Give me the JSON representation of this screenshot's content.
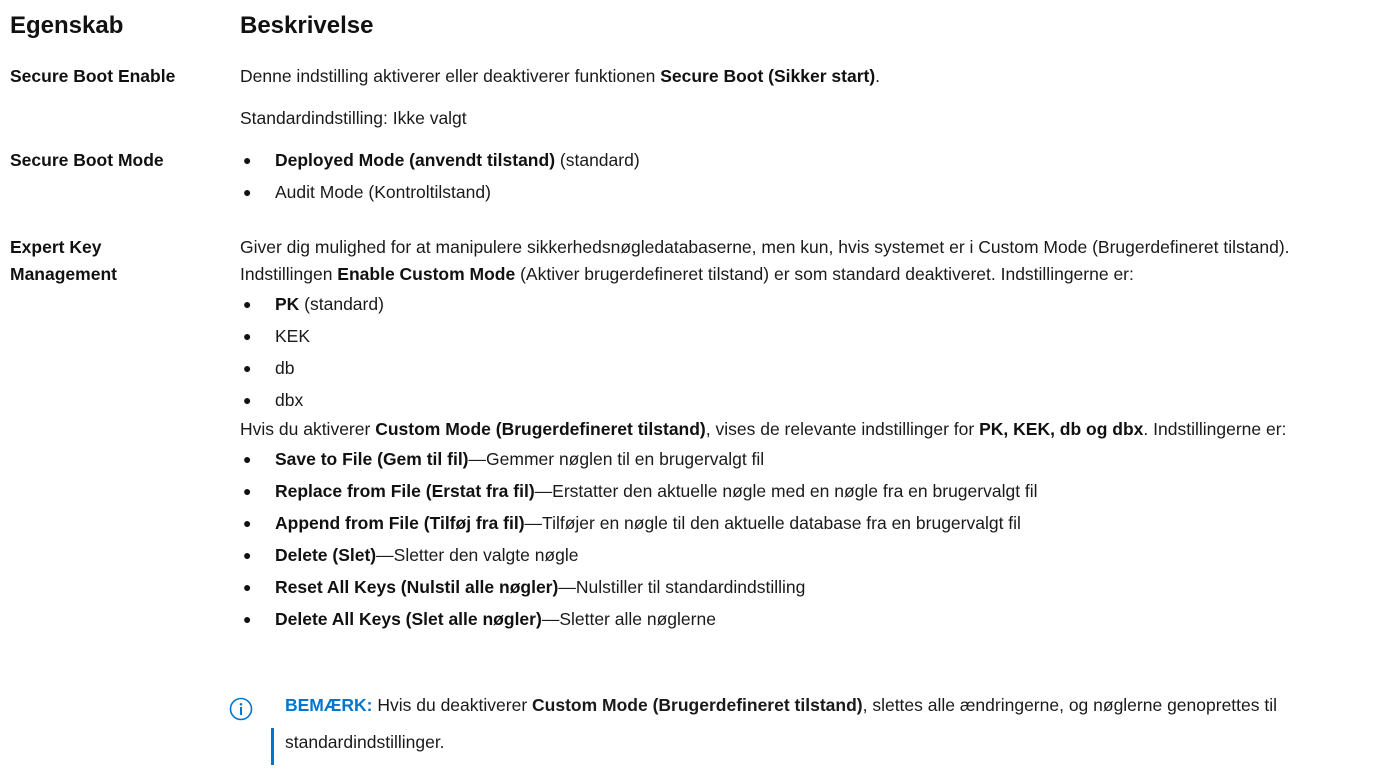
{
  "header": {
    "col1": "Egenskab",
    "col2": "Beskrivelse"
  },
  "rows": {
    "secure_boot_enable": {
      "label": "Secure Boot Enable",
      "line1_pre": "Denne indstilling aktiverer eller deaktiverer funktionen ",
      "line1_bold": "Secure Boot (Sikker start)",
      "line1_post": ".",
      "line2": "Standardindstilling: Ikke valgt"
    },
    "secure_boot_mode": {
      "label": "Secure Boot Mode",
      "items": [
        {
          "bold": "Deployed Mode (anvendt tilstand)",
          "text": " (standard)"
        },
        {
          "bold": "",
          "text": "Audit Mode (Kontroltilstand)"
        }
      ]
    },
    "expert_key": {
      "label": "Expert Key Management",
      "intro_pre": "Giver dig mulighed for at manipulere sikkerhedsnøgledatabaserne, men kun, hvis systemet er i Custom Mode (Brugerdefineret tilstand). Indstillingen ",
      "intro_bold": "Enable Custom Mode",
      "intro_post": " (Aktiver brugerdefineret tilstand) er som standard deaktiveret. Indstillingerne er:",
      "keys": [
        {
          "bold": "PK",
          "text": " (standard)"
        },
        {
          "bold": "",
          "text": "KEK"
        },
        {
          "bold": "",
          "text": "db"
        },
        {
          "bold": "",
          "text": "dbx"
        }
      ],
      "custom_pre": "Hvis du aktiverer ",
      "custom_bold1": "Custom Mode (Brugerdefineret tilstand)",
      "custom_mid": ", vises de relevante indstillinger for ",
      "custom_bold2": "PK, KEK, db og dbx",
      "custom_post": ". Indstillingerne er:",
      "options": [
        {
          "bold": "Save to File (Gem til fil)",
          "text": "—Gemmer nøglen til en brugervalgt fil"
        },
        {
          "bold": "Replace from File (Erstat fra fil)",
          "text": "—Erstatter den aktuelle nøgle med en nøgle fra en brugervalgt fil"
        },
        {
          "bold": "Append from File (Tilføj fra fil)",
          "text": "—Tilføjer en nøgle til den aktuelle database fra en brugervalgt fil"
        },
        {
          "bold": "Delete (Slet)",
          "text": "—Sletter den valgte nøgle"
        },
        {
          "bold": "Reset All Keys (Nulstil alle nøgler)",
          "text": "—Nulstiller til standardindstilling"
        },
        {
          "bold": "Delete All Keys (Slet alle nøgler)",
          "text": "—Sletter alle nøglerne"
        }
      ]
    }
  },
  "note": {
    "icon": "info-icon",
    "label": "BEMÆRK:",
    "pre": " Hvis du deaktiverer ",
    "bold": "Custom Mode (Brugerdefineret tilstand)",
    "post": ", slettes alle ændringerne, og nøglerne genoprettes til standardindstillinger."
  },
  "colors": {
    "accent": "#0076ce",
    "text": "#1a1a1a"
  }
}
